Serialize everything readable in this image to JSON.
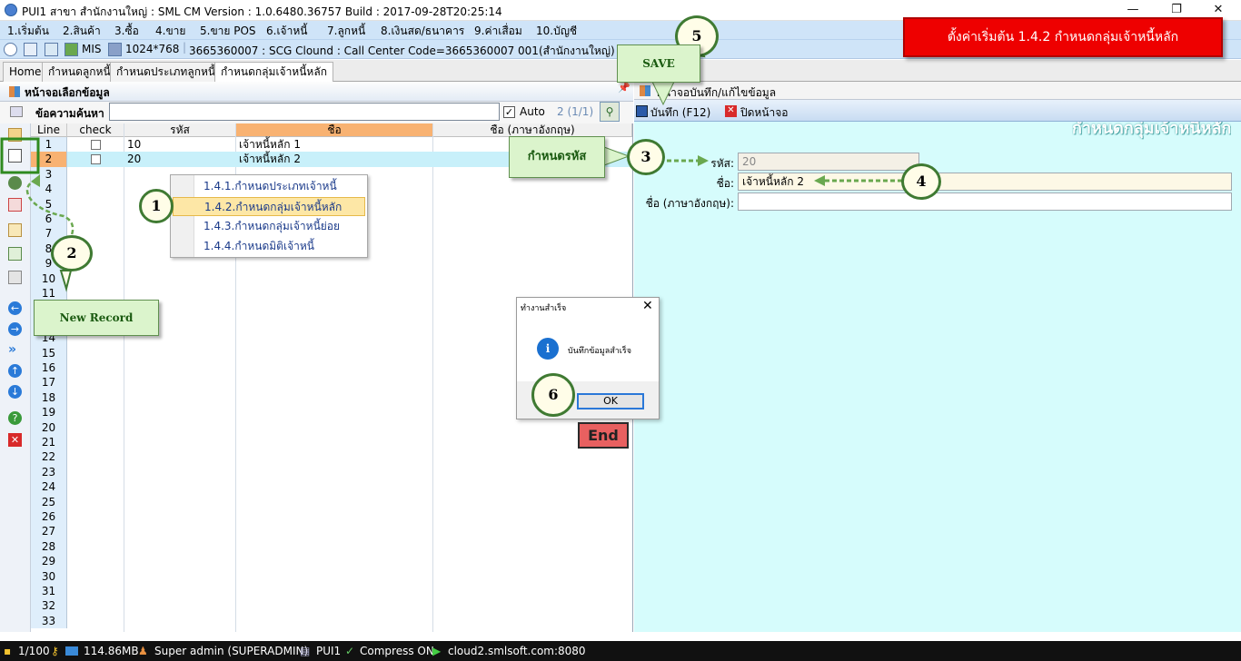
{
  "window": {
    "title": "PUI1 สาขา สำนักงานใหญ่ : SML CM Version : 1.0.6480.36757  Build : 2017-09-28T20:25:14",
    "minimize": "—",
    "restore": "❐",
    "close": "✕"
  },
  "menu": [
    "1.เริ่มต้น",
    "2.สินค้า",
    "3.ซื้อ",
    "4.ขาย",
    "5.ขาย POS",
    "6.เจ้าหนี้",
    "7.ลูกหนี้",
    "8.เงินสด/ธนาคาร",
    "9.ค่าเสื่อม",
    "10.บัญชี"
  ],
  "infobar": {
    "mis_label": "MIS",
    "resolution": "1024*768",
    "server_info": "3665360007 : SCG Clound : Call Center Code=3665360007 001(สำนักงานใหญ่)"
  },
  "tabs": [
    "Home",
    "กำหนดลูกหนี้",
    "กำหนดประเภทลูกหนี้",
    "กำหนดกลุ่มเจ้าหนี้หลัก"
  ],
  "left_panel": {
    "title": "หน้าจอเลือกข้อมูล",
    "search_label": "ข้อความค้นหา",
    "search_value": "",
    "auto_label": "Auto",
    "page_info": "2 (1/1)",
    "columns": [
      "Line",
      "check",
      "รหัส",
      "ชื่อ",
      "ชื่อ (ภาษาอังกฤษ)"
    ],
    "rows": [
      {
        "line": "1",
        "code": "10",
        "name": "เจ้าหนี้หลัก 1",
        "name_en": ""
      },
      {
        "line": "2",
        "code": "20",
        "name": "เจ้าหนี้หลัก 2",
        "name_en": ""
      },
      {
        "line": "3"
      },
      {
        "line": "4"
      },
      {
        "line": "5"
      },
      {
        "line": "6"
      },
      {
        "line": "7"
      },
      {
        "line": "8"
      },
      {
        "line": "9"
      },
      {
        "line": "10"
      },
      {
        "line": "11"
      },
      {
        "line": "12"
      },
      {
        "line": "13"
      },
      {
        "line": "14"
      },
      {
        "line": "15"
      },
      {
        "line": "16"
      },
      {
        "line": "17"
      },
      {
        "line": "18"
      },
      {
        "line": "19"
      },
      {
        "line": "20"
      },
      {
        "line": "21"
      },
      {
        "line": "22"
      },
      {
        "line": "23"
      },
      {
        "line": "24"
      },
      {
        "line": "25"
      },
      {
        "line": "26"
      },
      {
        "line": "27"
      },
      {
        "line": "28"
      },
      {
        "line": "29"
      },
      {
        "line": "30"
      },
      {
        "line": "31"
      },
      {
        "line": "32"
      },
      {
        "line": "33"
      }
    ]
  },
  "context_menu": [
    "1.4.1.กำหนดประเภทเจ้าหนี้",
    "1.4.2.กำหนดกลุ่มเจ้าหนี้หลัก",
    "1.4.3.กำหนดกลุ่มเจ้าหนี้ย่อย",
    "1.4.4.กำหนดมิติเจ้าหนี้"
  ],
  "right_panel": {
    "title": "หน้าจอบันทึก/แก้ไขข้อมูล",
    "save_button": "บันทึก (F12)",
    "close_button": "ปิดหน้าจอ",
    "watermark": "กำหนดกลุ่มเจ้าหนี้หลัก",
    "code_label": "รหัส:",
    "code_value": "20",
    "name_label": "ชื่อ:",
    "name_value": "เจ้าหนี้หลัก 2",
    "name_en_label": "ชื่อ (ภาษาอังกฤษ):",
    "name_en_value": ""
  },
  "dialog": {
    "title": "ทำงานสำเร็จ",
    "message": "บันทึกข้อมูลสำเร็จ",
    "ok_button": "OK"
  },
  "end_button": "End",
  "annotations": {
    "banner": "ตั้งค่าเริ่มต้น 1.4.2 กำหนดกลุ่มเจ้าหนี้หลัก",
    "step_1": "1",
    "step_2": "2",
    "step_3": "3",
    "step_4": "4",
    "step_5": "5",
    "step_6": "6",
    "new_record": "New Record",
    "set_code": "กำหนดรหัส",
    "save": "SAVE"
  },
  "statusbar": {
    "page": "1/100",
    "memory": "114.86MB",
    "user": "Super admin (SUPERADMIN)",
    "db": "PUI1",
    "compress": "Compress ON",
    "server": "cloud2.smlsoft.com:8080"
  },
  "colors": {
    "menu_bg": "#cfe4f8",
    "right_panel_bg": "#d6fcfc",
    "name_col_header": "#f8b272",
    "banner_red": "#ee0000",
    "callout_green": "#3f7a32",
    "highlight_row": "#c8f0fa"
  }
}
